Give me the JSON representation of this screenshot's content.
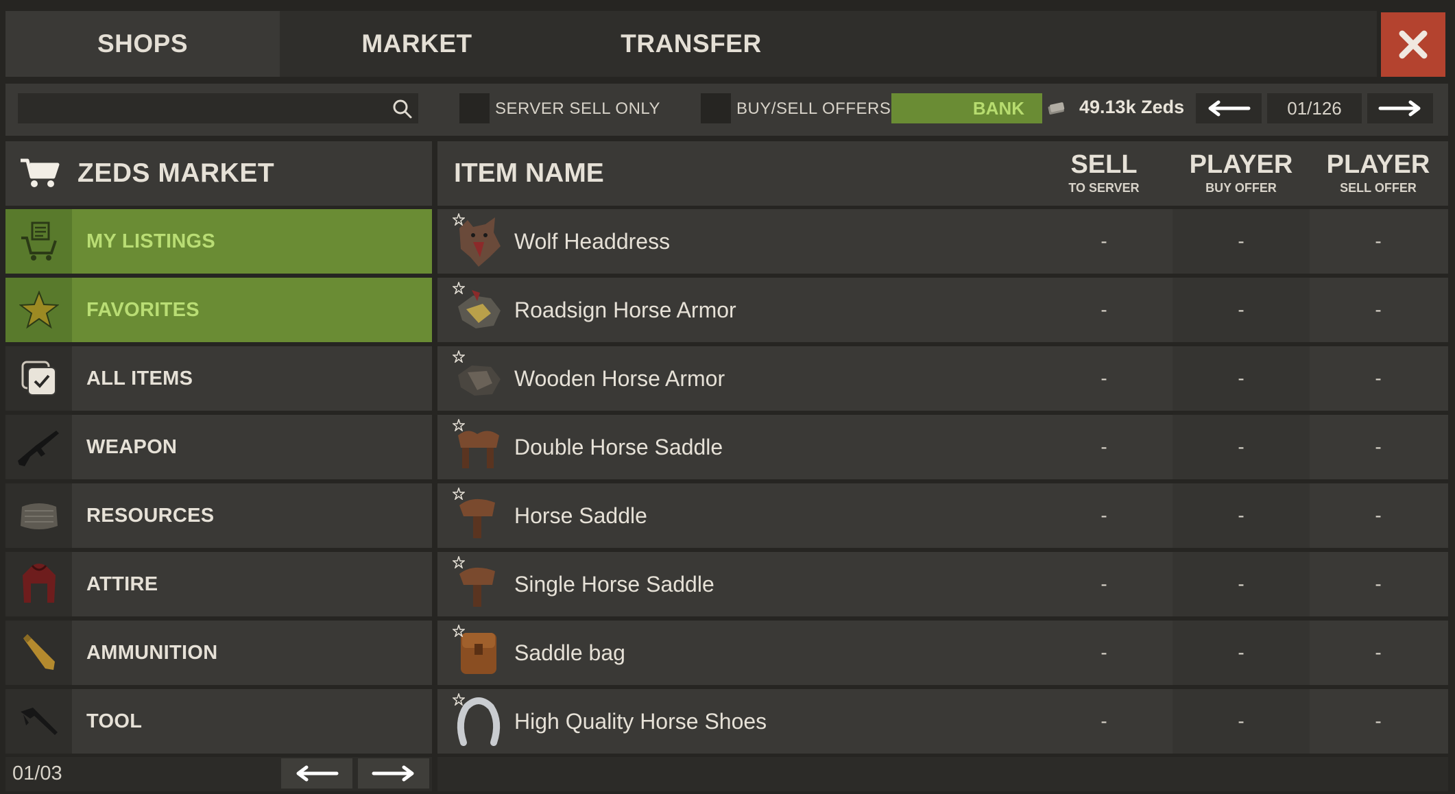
{
  "tabs": [
    {
      "label": "SHOPS"
    },
    {
      "label": "MARKET"
    },
    {
      "label": "TRANSFER"
    }
  ],
  "filters": {
    "search_placeholder": "",
    "server_sell_only_label": "SERVER SELL ONLY",
    "buy_sell_offers_label": "BUY/SELL OFFERS ON",
    "bank_label": "BANK",
    "balance": "49.13k Zeds",
    "page": "01/126"
  },
  "sidebar": {
    "title": "ZEDS MARKET",
    "items": [
      {
        "label": "MY LISTINGS",
        "icon": "cart-list-icon",
        "active": true
      },
      {
        "label": "FAVORITES",
        "icon": "star-icon",
        "active": true
      },
      {
        "label": "ALL ITEMS",
        "icon": "checkbox-icon",
        "active": false
      },
      {
        "label": "WEAPON",
        "icon": "rifle-icon",
        "active": false
      },
      {
        "label": "RESOURCES",
        "icon": "bag-icon",
        "active": false
      },
      {
        "label": "ATTIRE",
        "icon": "hoodie-icon",
        "active": false
      },
      {
        "label": "AMMUNITION",
        "icon": "bullet-icon",
        "active": false
      },
      {
        "label": "TOOL",
        "icon": "tool-icon",
        "active": false
      }
    ],
    "page": "01/03"
  },
  "table": {
    "columns": {
      "name": "ITEM NAME",
      "sell_title": "SELL",
      "sell_sub": "TO SERVER",
      "buy_title": "PLAYER",
      "buy_sub": "BUY OFFER",
      "sellp_title": "PLAYER",
      "sellp_sub": "SELL OFFER"
    },
    "rows": [
      {
        "name": "Wolf Headdress",
        "icon": "wolf-headdress-icon",
        "sell": "-",
        "buy": "-",
        "sellp": "-"
      },
      {
        "name": "Roadsign Horse Armor",
        "icon": "roadsign-armor-icon",
        "sell": "-",
        "buy": "-",
        "sellp": "-"
      },
      {
        "name": "Wooden Horse Armor",
        "icon": "wooden-armor-icon",
        "sell": "-",
        "buy": "-",
        "sellp": "-"
      },
      {
        "name": "Double Horse Saddle",
        "icon": "double-saddle-icon",
        "sell": "-",
        "buy": "-",
        "sellp": "-"
      },
      {
        "name": "Horse Saddle",
        "icon": "saddle-icon",
        "sell": "-",
        "buy": "-",
        "sellp": "-"
      },
      {
        "name": "Single Horse Saddle",
        "icon": "single-saddle-icon",
        "sell": "-",
        "buy": "-",
        "sellp": "-"
      },
      {
        "name": "Saddle bag",
        "icon": "saddle-bag-icon",
        "sell": "-",
        "buy": "-",
        "sellp": "-"
      },
      {
        "name": "High Quality Horse Shoes",
        "icon": "horseshoe-icon",
        "sell": "-",
        "buy": "-",
        "sellp": "-"
      }
    ]
  },
  "colors": {
    "active_green": "#6a8c34",
    "active_text": "#b9dd74",
    "close_red": "#b4432f",
    "panel": "#3a3936"
  }
}
